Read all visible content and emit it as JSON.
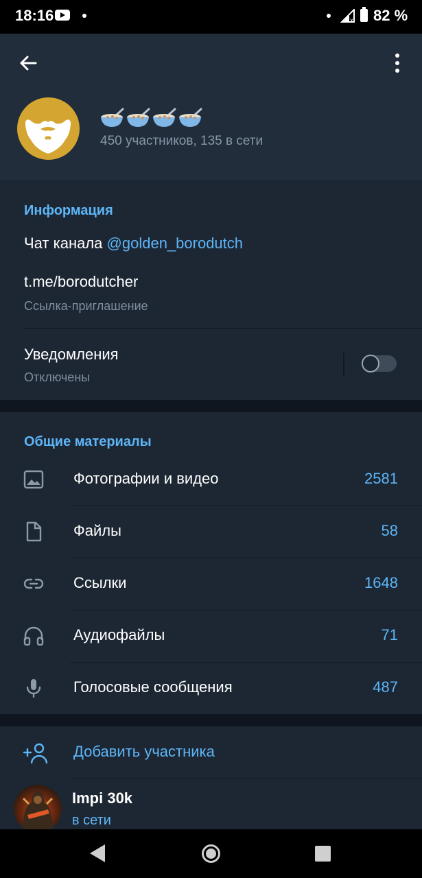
{
  "status_bar": {
    "time": "18:16",
    "battery": "82 %",
    "icons": [
      "youtube-icon",
      "notification-dot-icon",
      "signal-icon",
      "battery-icon"
    ]
  },
  "header": {
    "back_icon": "arrow-left-icon",
    "menu_icon": "more-vertical-icon",
    "avatar_icon": "beard-icon",
    "title_emoji_count": 4,
    "title_emoji": "bowl-with-spoon-icon",
    "subtitle": "450 участников, 135 в сети"
  },
  "info": {
    "heading": "Информация",
    "chat_label": "Чат канала",
    "chat_link": "@golden_borodutch",
    "invite_link": "t.me/borodutcher",
    "invite_caption": "Ссылка-приглашение",
    "notifications_label": "Уведомления",
    "notifications_state": "Отключены",
    "notifications_enabled": false
  },
  "media": {
    "heading": "Общие материалы",
    "items": [
      {
        "icon": "photo-icon",
        "label": "Фотографии и видео",
        "count": "2581"
      },
      {
        "icon": "file-icon",
        "label": "Файлы",
        "count": "58"
      },
      {
        "icon": "link-icon",
        "label": "Ссылки",
        "count": "1648"
      },
      {
        "icon": "headphones-icon",
        "label": "Аудиофайлы",
        "count": "71"
      },
      {
        "icon": "microphone-icon",
        "label": "Голосовые сообщения",
        "count": "487"
      }
    ]
  },
  "members": {
    "add_label": "Добавить участника",
    "add_icon": "add-user-icon",
    "list": [
      {
        "name": "Impi 30k",
        "status": "в сети"
      }
    ]
  },
  "colors": {
    "accent": "#5eb5f7",
    "background": "#1c2733",
    "header": "#212d3b",
    "avatar_gold": "#d4a631"
  }
}
